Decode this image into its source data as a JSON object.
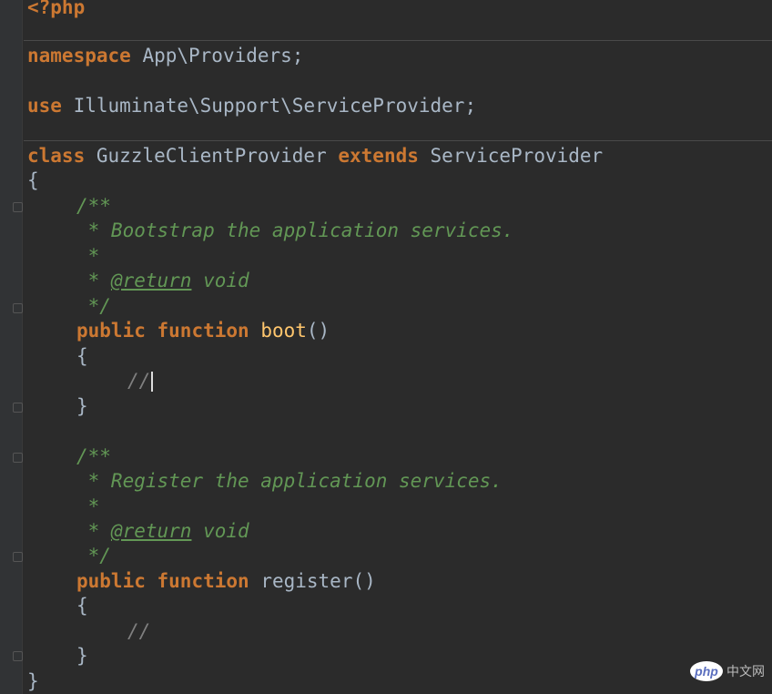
{
  "code": {
    "php_open": "<?php",
    "ns_keyword": "namespace",
    "ns_value": " App\\Providers;",
    "use_keyword": "use",
    "use_value": " Illuminate\\Support\\ServiceProvider;",
    "class_keyword": "class",
    "class_name": " GuzzleClientProvider ",
    "extends_keyword": "extends",
    "parent_class": " ServiceProvider",
    "brace_open": "{",
    "brace_close": "}",
    "methods": [
      {
        "doc_open": "/**",
        "doc_summary": " * Bootstrap the application services.",
        "doc_blank": " *",
        "doc_star": " * ",
        "doc_return_tag": "@return",
        "doc_return_type": " void",
        "doc_close": " */",
        "modifier": "public",
        "func_keyword": "function",
        "name": "boot",
        "params": "()",
        "brace_open": "{",
        "body": "//",
        "brace_close": "}"
      },
      {
        "doc_open": "/**",
        "doc_summary": " * Register the application services.",
        "doc_blank": " *",
        "doc_star": " * ",
        "doc_return_tag": "@return",
        "doc_return_type": " void",
        "doc_close": " */",
        "modifier": "public",
        "func_keyword": "function",
        "name": "register",
        "params": "()",
        "brace_open": "{",
        "body": "//",
        "brace_close": "}"
      }
    ]
  },
  "watermark": {
    "logo_text": "php",
    "site_text": "中文网"
  },
  "colors": {
    "background": "#2b2b2b",
    "keyword": "#cc7832",
    "function_name": "#ffc66d",
    "doc_comment": "#629755",
    "plain_text": "#a9b7c6"
  }
}
